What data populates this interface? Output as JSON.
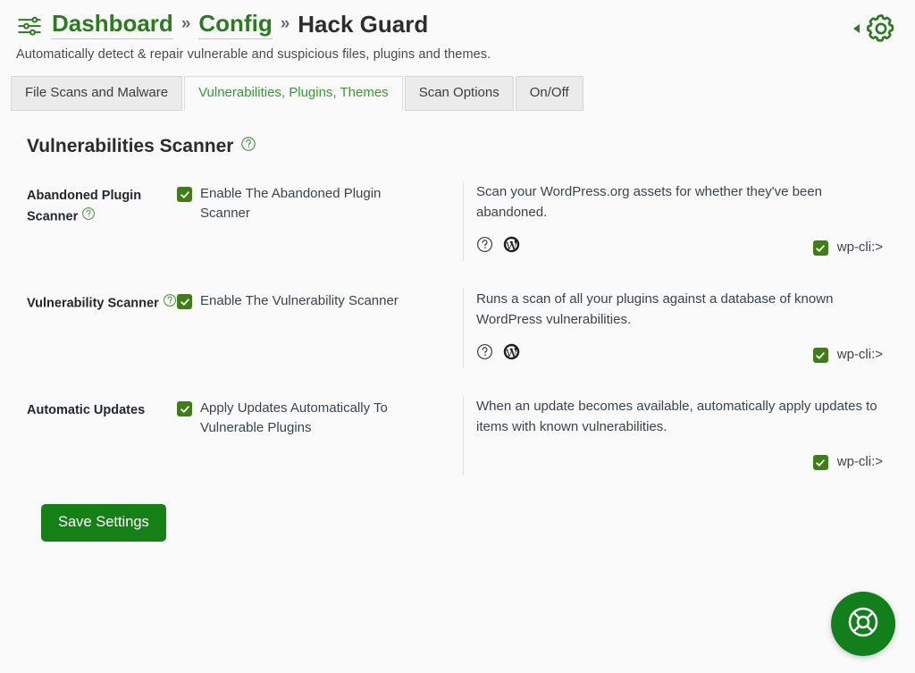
{
  "header": {
    "icon": "sliders-icon",
    "breadcrumb": [
      {
        "label": "Dashboard",
        "type": "link"
      },
      {
        "label": "»",
        "type": "separator"
      },
      {
        "label": "Config",
        "type": "link"
      },
      {
        "label": "»",
        "type": "separator"
      },
      {
        "label": "Hack Guard",
        "type": "current"
      }
    ],
    "subtitle": "Automatically detect & repair vulnerable and suspicious files, plugins and themes.",
    "gear_icon": "gear-icon",
    "collapse_icon": "caret-left-icon"
  },
  "tabs": [
    {
      "label": "File Scans and Malware",
      "active": false
    },
    {
      "label": "Vulnerabilities, Plugins, Themes",
      "active": true
    },
    {
      "label": "Scan Options",
      "active": false
    },
    {
      "label": "On/Off",
      "active": false
    }
  ],
  "section": {
    "title": "Vulnerabilities Scanner",
    "help_icon": "help-circle-icon"
  },
  "rows": [
    {
      "label": "Abandoned Plugin Scanner",
      "has_label_help": true,
      "option_label": "Enable The Abandoned Plugin Scanner",
      "option_checked": true,
      "description": "Scan your WordPress.org assets for whether they've been abandoned.",
      "icons": [
        "help-circle-icon",
        "wordpress-icon"
      ],
      "wpcli_label": "wp-cli:>",
      "wpcli_checked": true
    },
    {
      "label": "Vulnerability Scanner",
      "has_label_help": true,
      "option_label": "Enable The Vulnerability Scanner",
      "option_checked": true,
      "description": "Runs a scan of all your plugins against a database of known WordPress vulnerabilities.",
      "icons": [
        "help-circle-icon",
        "wordpress-icon"
      ],
      "wpcli_label": "wp-cli:>",
      "wpcli_checked": true
    },
    {
      "label": "Automatic Updates",
      "has_label_help": false,
      "option_label": "Apply Updates Automatically To Vulnerable Plugins",
      "option_checked": true,
      "description": "When an update becomes available, automatically apply updates to items with known vulnerabilities.",
      "icons": [],
      "wpcli_label": "wp-cli:>",
      "wpcli_checked": true
    }
  ],
  "footer": {
    "save_label": "Save Settings",
    "fab_icon": "lifebuoy-icon"
  },
  "colors": {
    "accent_green": "#2a7d1e",
    "tab_active_green": "#2f9e2f",
    "checkbox_green": "#3f7e16",
    "save_green": "#158016",
    "fab_green": "#12801a",
    "page_bg": "#fafafa"
  }
}
